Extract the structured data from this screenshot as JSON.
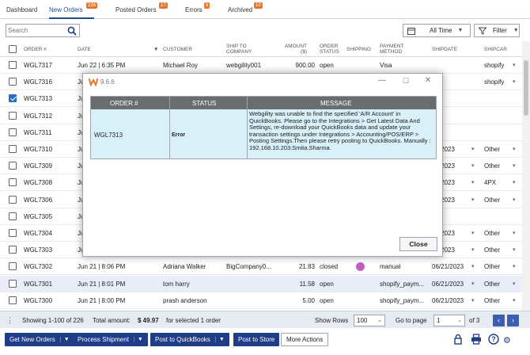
{
  "tabs": [
    {
      "label": "Dashboard",
      "badge": ""
    },
    {
      "label": "New Orders",
      "badge": "226"
    },
    {
      "label": "Posted Orders",
      "badge": "17"
    },
    {
      "label": "Errors",
      "badge": "5"
    },
    {
      "label": "Archived",
      "badge": "10"
    }
  ],
  "toolbar": {
    "search_placeholder": "Search",
    "date_filter": "All Time",
    "filter_label": "Filter"
  },
  "table": {
    "headers": {
      "order": "ORDER #",
      "date": "DATE",
      "customer": "CUSTOMER",
      "ship_to": "SHIP TO COMPANY",
      "amount": "AMOUNT ($)",
      "status": "ORDER STATUS",
      "shipping": "SHIPPING",
      "payment": "PAYMENT METHOD",
      "shipdate": "SHIPDATE",
      "shipcarrier": "SHIPCAR"
    },
    "rows": [
      {
        "order": "WGL7317",
        "date": "Jun 22 | 6:35 PM",
        "customer": "Michael Roy",
        "ship_to": "webgility001",
        "amount": "900.00",
        "status": "open",
        "payment": "Visa",
        "shipdate": "",
        "carrier": "shopify",
        "checked": false
      },
      {
        "order": "WGL7316",
        "date": "Ju",
        "customer": "",
        "ship_to": "",
        "amount": "",
        "status": "",
        "payment": "",
        "shipdate": "",
        "carrier": "shopify",
        "checked": false
      },
      {
        "order": "WGL7313",
        "date": "Ju",
        "customer": "",
        "ship_to": "",
        "amount": "",
        "status": "",
        "payment": "",
        "shipdate": "",
        "carrier": "",
        "checked": true
      },
      {
        "order": "WGL7312",
        "date": "Ju",
        "customer": "",
        "ship_to": "",
        "amount": "",
        "status": "",
        "payment": "",
        "shipdate": "",
        "carrier": "",
        "checked": false
      },
      {
        "order": "WGL7311",
        "date": "Ju",
        "customer": "",
        "ship_to": "",
        "amount": "",
        "status": "",
        "payment": "",
        "shipdate": "",
        "carrier": "",
        "checked": false
      },
      {
        "order": "WGL7310",
        "date": "Ju",
        "customer": "",
        "ship_to": "",
        "amount": "",
        "status": "",
        "payment": "",
        "shipdate": "22/2023",
        "carrier": "Other",
        "checked": false
      },
      {
        "order": "WGL7309",
        "date": "Ju",
        "customer": "",
        "ship_to": "",
        "amount": "",
        "status": "",
        "payment": "",
        "shipdate": "22/2023",
        "carrier": "Other",
        "checked": false
      },
      {
        "order": "WGL7308",
        "date": "Ju",
        "customer": "",
        "ship_to": "",
        "amount": "",
        "status": "",
        "payment": "",
        "shipdate": "22/2023",
        "carrier": "4PX",
        "checked": false
      },
      {
        "order": "WGL7306",
        "date": "Ju",
        "customer": "",
        "ship_to": "",
        "amount": "",
        "status": "",
        "payment": "",
        "shipdate": "22/2023",
        "carrier": "Other",
        "checked": false
      },
      {
        "order": "WGL7305",
        "date": "Ju",
        "customer": "",
        "ship_to": "",
        "amount": "",
        "status": "",
        "payment": "",
        "shipdate": "",
        "carrier": "",
        "checked": false
      },
      {
        "order": "WGL7304",
        "date": "Ju",
        "customer": "",
        "ship_to": "",
        "amount": "",
        "status": "",
        "payment": "",
        "shipdate": "22/2023",
        "carrier": "Other",
        "checked": false
      },
      {
        "order": "WGL7303",
        "date": "Ju",
        "customer": "",
        "ship_to": "",
        "amount": "",
        "status": "",
        "payment": "",
        "shipdate": "22/2023",
        "carrier": "Other",
        "checked": false
      },
      {
        "order": "WGL7302",
        "date": "Jun 21 | 8:06 PM",
        "customer": "Adriana Walker",
        "ship_to": "BigCompany0...",
        "amount": "21.83",
        "status": "closed",
        "payment": "manual",
        "shipdate": "06/21/2023",
        "carrier": "Other",
        "checked": false
      },
      {
        "order": "WGL7301",
        "date": "Jun 21 | 8:01 PM",
        "customer": "tom harry",
        "ship_to": "",
        "amount": "11.58",
        "status": "open",
        "payment": "shopify_paym...",
        "shipdate": "06/21/2023",
        "carrier": "Other",
        "checked": false
      },
      {
        "order": "WGL7300",
        "date": "Jun 21 | 8:00 PM",
        "customer": "prash anderson",
        "ship_to": "",
        "amount": "5.00",
        "status": "open",
        "payment": "shopify_paym...",
        "shipdate": "06/21/2023",
        "carrier": "Other",
        "checked": false
      }
    ]
  },
  "footer": {
    "showing": "Showing 1-100 of 226",
    "total_amount_label": "Total amount:",
    "total_amount": "$ 49.97",
    "total_suffix": "for selected 1 order",
    "show_rows_label": "Show Rows",
    "show_rows_value": "100",
    "goto_label": "Go to page",
    "page_value": "1",
    "of_pages": "of 3"
  },
  "actions": {
    "get_new_orders": "Get New Orders",
    "process_shipment": "Process Shipment",
    "post_to_quickbooks": "Post to QuickBooks",
    "post_to_store": "Post to Store",
    "more_actions": "More Actions"
  },
  "modal": {
    "version": "9.6.6",
    "col_order": "ORDER #",
    "col_status": "STATUS",
    "col_message": "MESSAGE",
    "order": "WGL7313",
    "status": "Error",
    "message": "Webgility was unable to find the specified 'A/R Account' in QuickBooks. Please go to the Integrations > Get Latest Data And Settings, re-download your QuickBooks data and update your transaction settings under Integrations > Accounting/POS/ERP > Posting Settings.Then please retry posting to QuickBooks.  Manually : 192.168.10.203:Smita.Sharma.",
    "close_label": "Close"
  },
  "colors": {
    "accent": "#1f3c88",
    "badge": "#e8762c",
    "modal_row": "#d8f1f8",
    "modal_header": "#6a6d70"
  }
}
